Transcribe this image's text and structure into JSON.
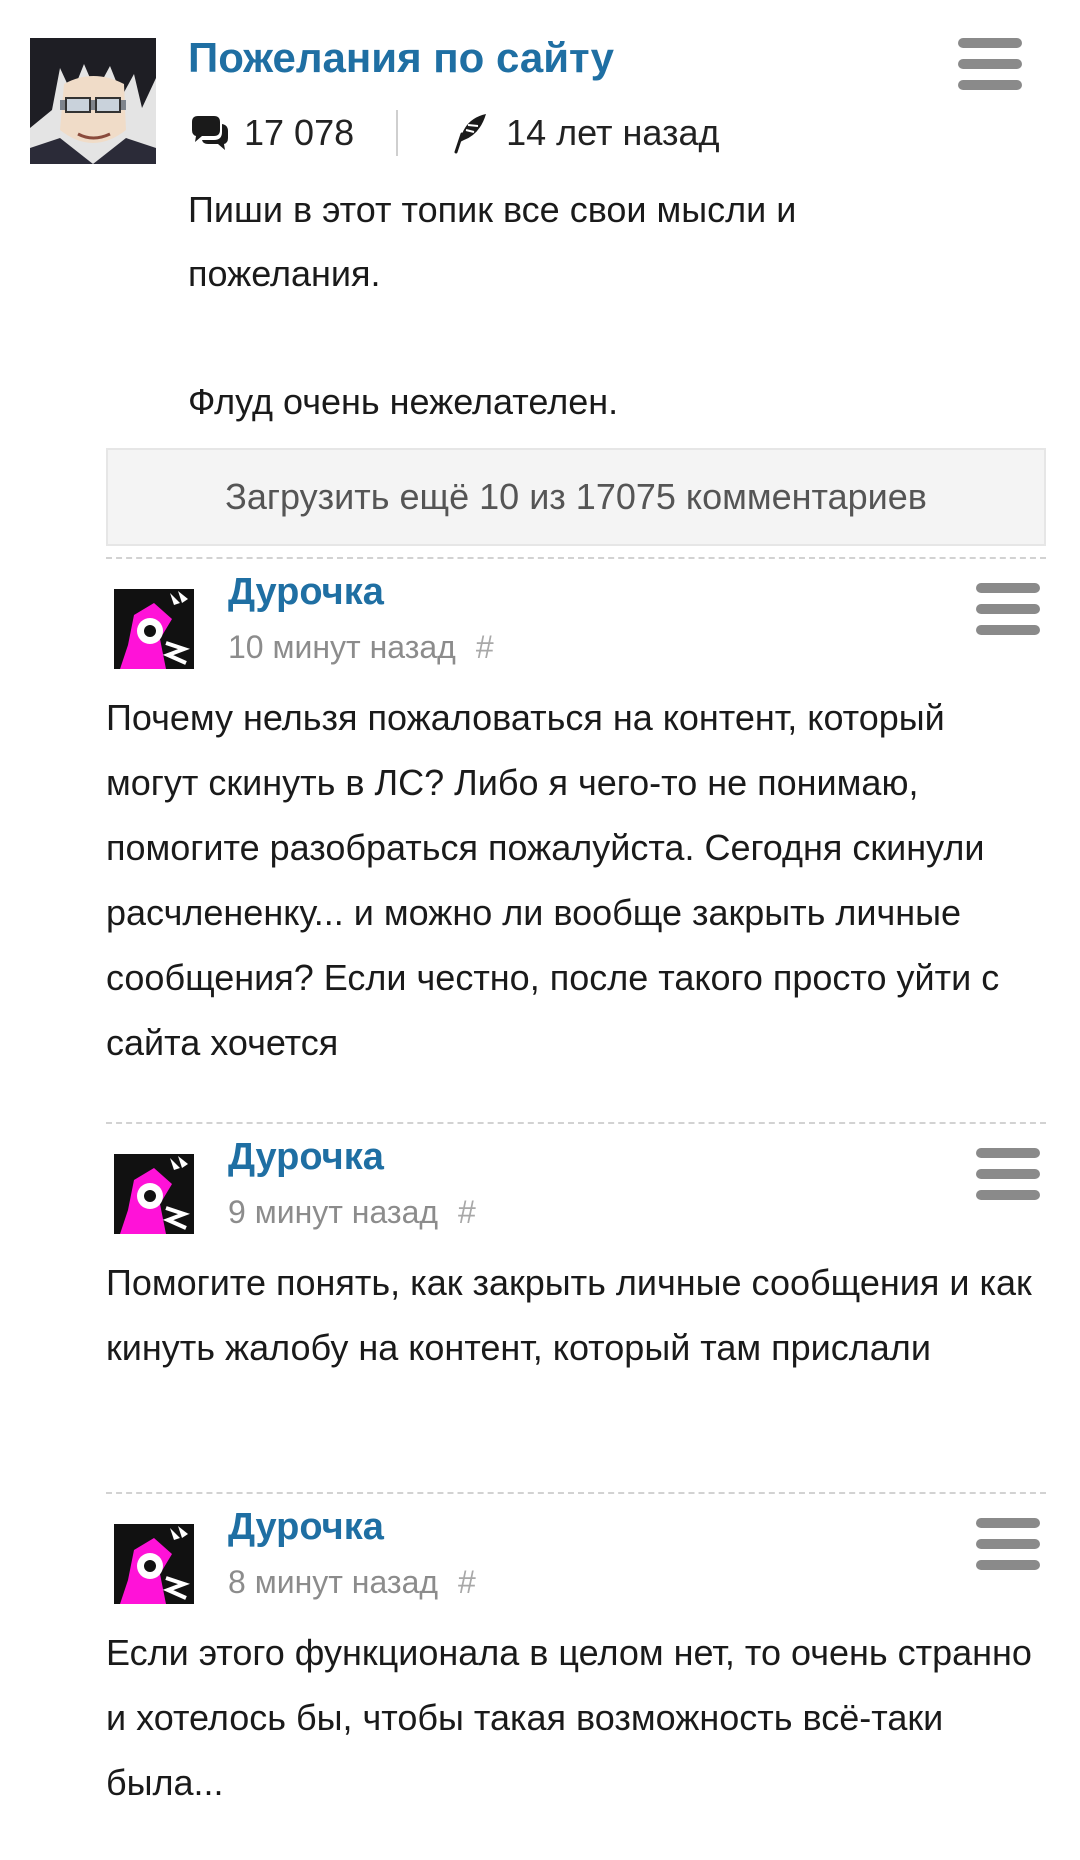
{
  "topic": {
    "title": "Пожелания по сайту",
    "comment_count": "17 078",
    "age": "14 лет назад",
    "body_line1": "Пиши в этот топик все свои мысли и пожелания.",
    "body_line2": "Флуд очень нежелателен."
  },
  "load_more_label": "Загрузить ещё 10 из 17075 комментариев",
  "comments": [
    {
      "author": "Дурочка",
      "time": "10 минут назад",
      "hash": "#",
      "text": "Почему нельзя пожаловаться на контент, который могут скинуть в ЛС? Либо я чего-то не понимаю, помогите разобраться пожалуйста. Сегодня скинули расчлененку... и можно ли вообще закрыть личные сообщения? Если честно, после такого просто уйти с сайта хочется"
    },
    {
      "author": "Дурочка",
      "time": "9 минут назад",
      "hash": "#",
      "text": "Помогите понять, как закрыть личные сообщения и как кинуть жалобу на контент, который там прислали"
    },
    {
      "author": "Дурочка",
      "time": "8 минут назад",
      "hash": "#",
      "text": "Если этого функционала в целом нет, то очень странно и хотелось бы, чтобы такая возможность всё-таки была..."
    }
  ],
  "icons": {
    "comments": "speech-bubbles-icon",
    "age": "feather-quill-icon",
    "menu": "hamburger-menu-icon"
  },
  "colors": {
    "link": "#1f6fa3",
    "muted": "#8c8c8c",
    "avatar_accent": "#ff12d8"
  }
}
